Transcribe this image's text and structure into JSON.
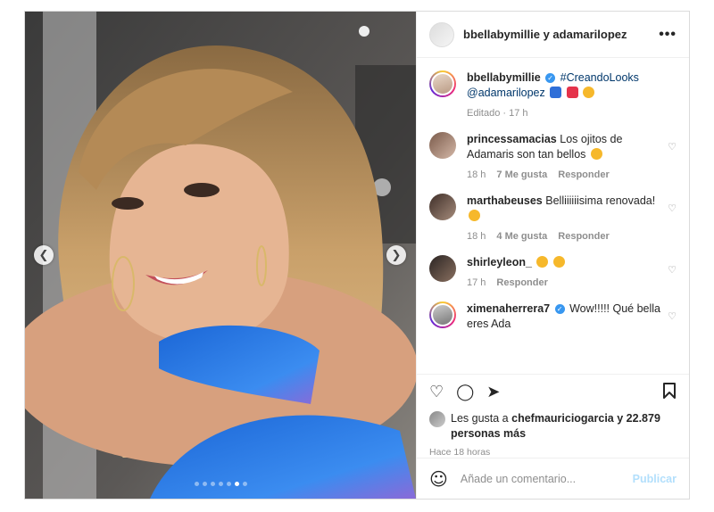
{
  "header": {
    "title": "bbellabymillie y adamarilopez",
    "more": "•••"
  },
  "caption": {
    "user": "bbellabymillie",
    "hashtag": "#CreandoLooks",
    "mention": "@adamarilopez",
    "meta": "Editado · 17 h"
  },
  "comments": [
    {
      "user": "princessamacias",
      "text": "Los ojitos de Adamaris son tan bellos",
      "time": "18 h",
      "likes": "7 Me gusta",
      "reply": "Responder"
    },
    {
      "user": "marthabeuses",
      "text": "Belliiiiiisima renovada!",
      "time": "18 h",
      "likes": "4 Me gusta",
      "reply": "Responder"
    },
    {
      "user": "shirleyleon_",
      "text": "",
      "time": "17 h",
      "likes": "",
      "reply": "Responder"
    },
    {
      "user": "ximenaherrera7",
      "text": "Wow!!!!! Qué bella eres Ada ",
      "time": "",
      "likes": "",
      "reply": ""
    }
  ],
  "likes": {
    "prefix": "Les gusta a",
    "user": "chefmauriciogarcia",
    "rest": "y 22.879 personas más"
  },
  "time_ago": "Hace 18 horas",
  "composer": {
    "placeholder": "Añade un comentario...",
    "publish": "Publicar"
  },
  "carousel": {
    "count": 7,
    "active_index": 5
  },
  "icons": {
    "like": "heart-icon",
    "comment": "comment-icon",
    "share": "share-icon",
    "save": "bookmark-icon",
    "emoji": "smile-icon"
  }
}
